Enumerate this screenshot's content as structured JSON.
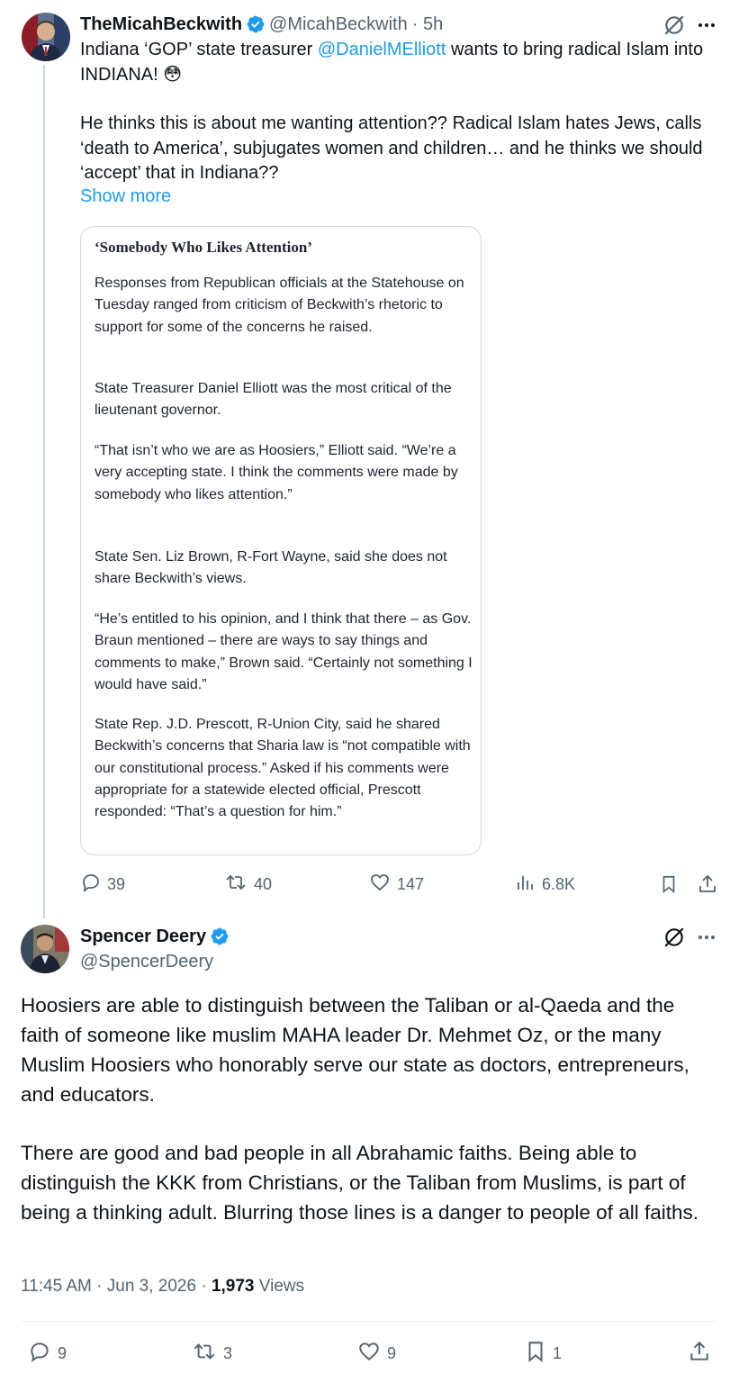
{
  "tweet1": {
    "display_name": "TheMicahBeckwith",
    "handle": "@MicahBeckwith",
    "time": "· 5h",
    "text_before_mention": "Indiana ‘GOP’ state treasurer ",
    "mention": "@DanielMElliott",
    "text_after_mention": " wants to bring radical Islam into INDIANA! 😳",
    "paragraph2": "He thinks this is about me wanting attention?? Radical Islam hates Jews, calls ‘death to America’, subjugates women and children… and he thinks we should ‘accept’ that in Indiana??",
    "show_more": "Show more",
    "card": {
      "title": "‘Somebody Who Likes Attention’",
      "paragraphs": [
        "Responses from Republican officials at the Statehouse on Tuesday ranged from criticism of Beckwith’s rhetoric to support for some of the concerns he raised.",
        "State Treasurer Daniel Elliott was the most critical of the lieutenant governor.",
        "“That isn’t who we are as Hoosiers,” Elliott said. “We’re a very accepting state. I think the comments were made by somebody who likes attention.”",
        "State Sen. Liz Brown, R-Fort Wayne, said she does not share Beckwith’s views.",
        "“He’s entitled to his opinion, and I think that there – as Gov. Braun mentioned – there are ways to say things and comments to make,” Brown said. “Certainly not something I would have said.”",
        "State Rep. J.D. Prescott, R-Union City, said he shared Beckwith’s concerns that Sharia law is “not compatible with our constitutional process.” Asked if his comments were appropriate for a statewide elected official, Prescott responded: “That’s a question for him.”"
      ]
    },
    "actions": {
      "replies": "39",
      "reposts": "40",
      "likes": "147",
      "views": "6.8K"
    }
  },
  "tweet2": {
    "display_name": "Spencer Deery",
    "handle": "@SpencerDeery",
    "paragraph1": "Hoosiers are able to distinguish between the Taliban or al-Qaeda and the faith of someone like muslim MAHA leader Dr. Mehmet Oz, or the many Muslim Hoosiers who honorably serve our state as doctors, entrepreneurs, and educators.",
    "paragraph2": "There are good and bad people in all Abrahamic faiths. Being able to distinguish the KKK from Christians, or the Taliban from Muslims, is part of being a thinking adult. Blurring those lines is a danger to people of all faiths.",
    "timestamp": "11:45 AM · Jun 3, 2026 · ",
    "views_count": "1,973",
    "views_label": " Views",
    "actions": {
      "replies": "9",
      "reposts": "3",
      "likes": "9",
      "bookmarks": "1"
    }
  },
  "colors": {
    "accent": "#1d9bf0",
    "secondary_text": "#536471",
    "primary_text": "#0f1419",
    "border": "#cfd9de"
  },
  "icons": [
    "verified-badge-icon",
    "grok-icon",
    "more-icon",
    "reply-icon",
    "repost-icon",
    "like-icon",
    "views-icon",
    "bookmark-icon",
    "share-icon"
  ]
}
